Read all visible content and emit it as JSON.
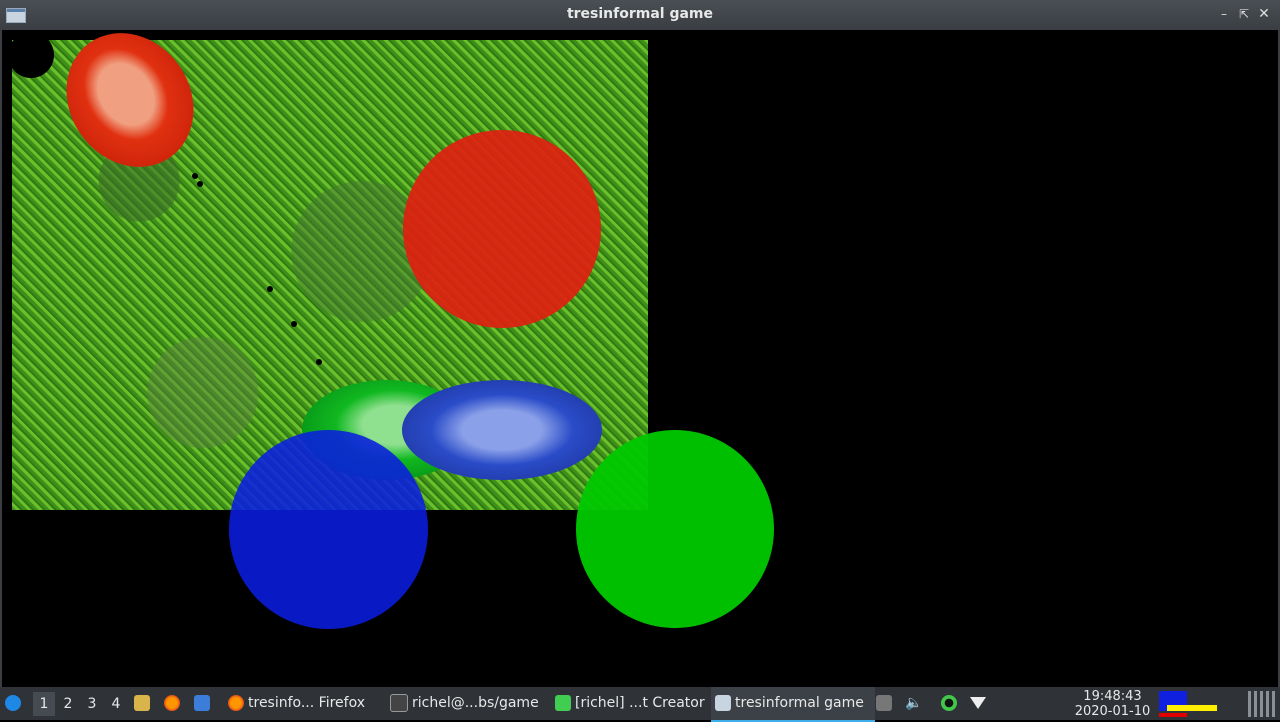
{
  "window": {
    "title": "tresinformal game"
  },
  "taskbar": {
    "desktops": [
      "1",
      "2",
      "3",
      "4"
    ],
    "active_desktop": "1",
    "tasks": [
      {
        "label": "tresinfo... Firefox",
        "icon": "firefox-icon"
      },
      {
        "label": "richel@...bs/game",
        "icon": "terminal-icon"
      },
      {
        "label": "[richel] ...t Creator",
        "icon": "qt-creator-icon"
      },
      {
        "label": "tresinformal game",
        "icon": "window-icon",
        "active": true
      }
    ],
    "clock": {
      "time": "19:48:43",
      "date": "2020-01-10"
    }
  },
  "colors": {
    "titlebar": "#3f4449",
    "taskbar": "#2f3338",
    "red": "#e02010",
    "green": "#00c800",
    "blue": "#0a1ee0",
    "accent": "#3daee9"
  }
}
